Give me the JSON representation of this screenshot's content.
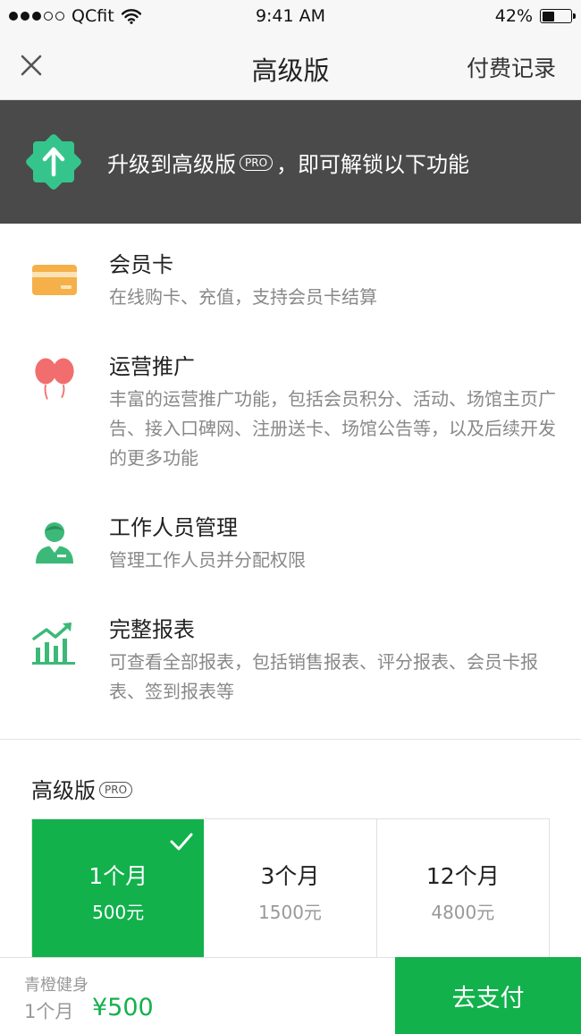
{
  "status_bar": {
    "carrier": "QCfit",
    "time": "9:41 AM",
    "battery": "42%",
    "battery_level": 0.42
  },
  "nav": {
    "title": "高级版",
    "right_link": "付费记录"
  },
  "banner": {
    "text_before": "升级到高级版",
    "pro_label": "PRO",
    "text_after": "，即可解锁以下功能"
  },
  "features": [
    {
      "icon": "membership-card-icon",
      "title": "会员卡",
      "desc": "在线购卡、充值，支持会员卡结算"
    },
    {
      "icon": "balloons-icon",
      "title": "运营推广",
      "desc": "丰富的运营推广功能，包括会员积分、活动、场馆主页广告、接入口碑网、注册送卡、场馆公告等，以及后续开发的更多功能"
    },
    {
      "icon": "staff-icon",
      "title": "工作人员管理",
      "desc": "管理工作人员并分配权限"
    },
    {
      "icon": "report-chart-icon",
      "title": "完整报表",
      "desc": "可查看全部报表，包括销售报表、评分报表、会员卡报表、签到报表等"
    }
  ],
  "plan_section": {
    "title": "高级版",
    "pro_label": "PRO",
    "plans": [
      {
        "duration": "1个月",
        "price": "500元",
        "selected": true
      },
      {
        "duration": "3个月",
        "price": "1500元",
        "selected": false
      },
      {
        "duration": "12个月",
        "price": "4800元",
        "selected": false
      }
    ]
  },
  "summary": {
    "gym_name": "青橙健身",
    "duration": "1个月",
    "price": "¥500",
    "pay_label": "去支付"
  },
  "colors": {
    "accent": "#12b14c",
    "banner_bg": "#4a4a4a",
    "card_icon": "#f5b04a",
    "balloon_icon": "#f26d6d",
    "staff_icon": "#3cb978"
  }
}
